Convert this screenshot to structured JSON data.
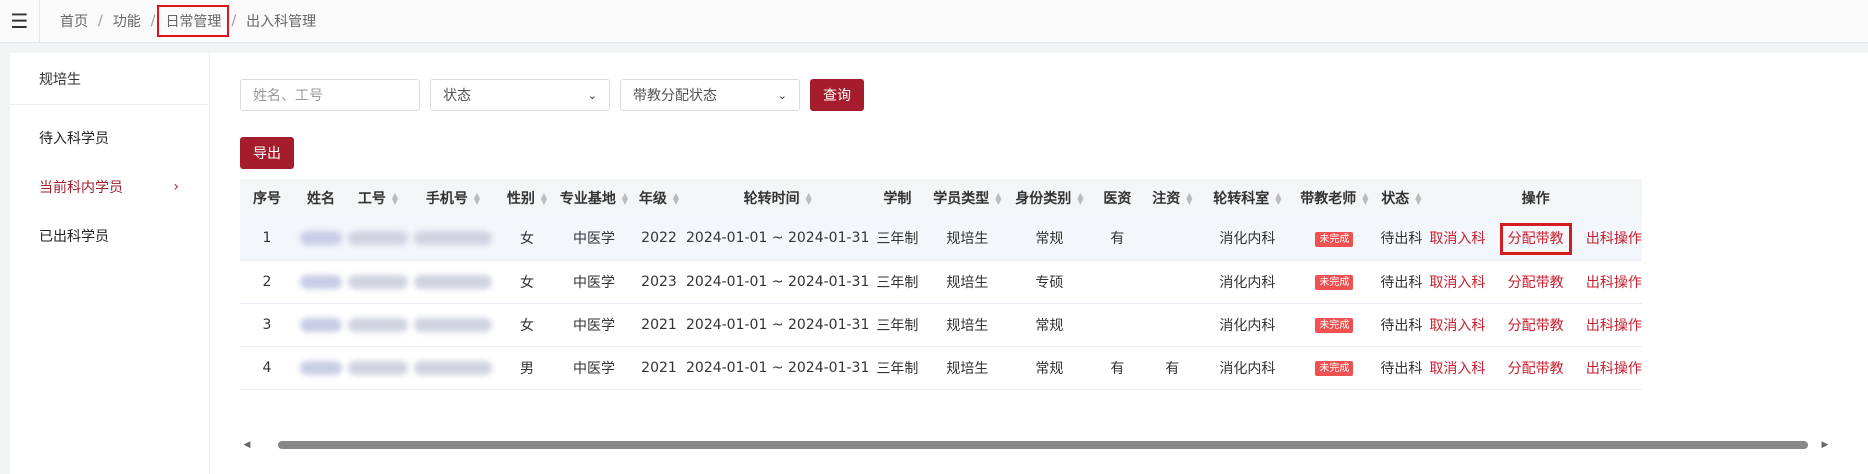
{
  "breadcrumb": [
    "首页",
    "功能",
    "日常管理",
    "出入科管理"
  ],
  "sidebar": {
    "header": "规培生",
    "items": [
      {
        "label": "待入科学员"
      },
      {
        "label": "当前科内学员"
      },
      {
        "label": "已出科学员"
      }
    ]
  },
  "filters": {
    "name_placeholder": "姓名、工号",
    "status_select": "状态",
    "teacher_status_select": "带教分配状态",
    "query_label": "查询",
    "export_label": "导出"
  },
  "table": {
    "columns": [
      "序号",
      "姓名",
      "工号",
      "手机号",
      "性别",
      "专业基地",
      "年级",
      "轮转时间",
      "学制",
      "学员类型",
      "身份类别",
      "医资",
      "注资",
      "轮转科室",
      "带教老师",
      "状态",
      "操作"
    ],
    "rows": [
      {
        "no": "1",
        "gender": "女",
        "base": "中医学",
        "grade": "2022",
        "period": "2024-01-01 ~ 2024-01-31",
        "system": "三年制",
        "type": "规培生",
        "identity": "常规",
        "doctor_qual": "有",
        "injection": "",
        "dept": "消化内科",
        "teacher": "未完成",
        "status": "待出科"
      },
      {
        "no": "2",
        "gender": "女",
        "base": "中医学",
        "grade": "2023",
        "period": "2024-01-01 ~ 2024-01-31",
        "system": "三年制",
        "type": "规培生",
        "identity": "专硕",
        "doctor_qual": "",
        "injection": "",
        "dept": "消化内科",
        "teacher": "未完成",
        "status": "待出科"
      },
      {
        "no": "3",
        "gender": "女",
        "base": "中医学",
        "grade": "2021",
        "period": "2024-01-01 ~ 2024-01-31",
        "system": "三年制",
        "type": "规培生",
        "identity": "常规",
        "doctor_qual": "",
        "injection": "",
        "dept": "消化内科",
        "teacher": "未完成",
        "status": "待出科"
      },
      {
        "no": "4",
        "gender": "男",
        "base": "中医学",
        "grade": "2021",
        "period": "2024-01-01 ~ 2024-01-31",
        "system": "三年制",
        "type": "规培生",
        "identity": "常规",
        "doctor_qual": "有",
        "injection": "有",
        "dept": "消化内科",
        "teacher": "未完成",
        "status": "待出科"
      }
    ],
    "actions": [
      "取消入科",
      "分配带教",
      "出科操作"
    ]
  },
  "icons": {
    "menu": "hamburger-icon",
    "sort": "sort-caret-icon",
    "chevron": "chevron-right-icon"
  },
  "colors": {
    "primary": "#a51d2d",
    "link": "#c8202e",
    "badge": "#f05050",
    "highlight_box": "#e0141a"
  }
}
